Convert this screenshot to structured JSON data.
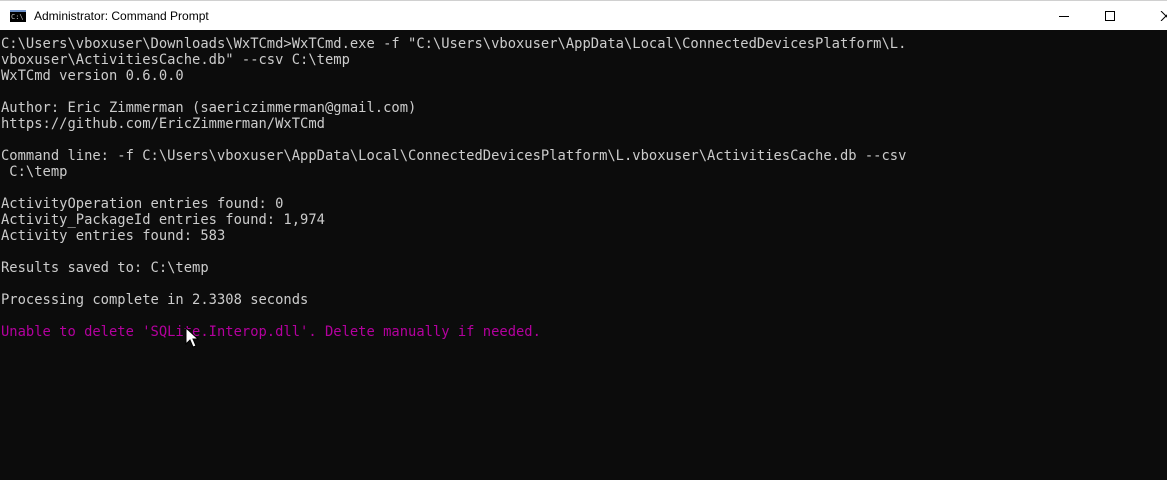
{
  "window": {
    "title": "Administrator: Command Prompt",
    "icon_text": "C:\\",
    "icon": "cmd-icon",
    "controls": {
      "minimize": "minimize-icon",
      "maximize": "maximize-icon",
      "close": "close-icon"
    }
  },
  "colors": {
    "console_bg": "#0c0c0c",
    "console_text": "#cccccc",
    "error_text": "#b4009e",
    "titlebar_bg": "#ffffff"
  },
  "console": {
    "lines": [
      {
        "text": "C:\\Users\\vboxuser\\Downloads\\WxTCmd>WxTCmd.exe -f \"C:\\Users\\vboxuser\\AppData\\Local\\ConnectedDevicesPlatform\\L.",
        "kind": "normal"
      },
      {
        "text": "vboxuser\\ActivitiesCache.db\" --csv C:\\temp",
        "kind": "normal"
      },
      {
        "text": "WxTCmd version 0.6.0.0",
        "kind": "normal"
      },
      {
        "text": "",
        "kind": "normal"
      },
      {
        "text": "Author: Eric Zimmerman (saericzimmerman@gmail.com)",
        "kind": "normal"
      },
      {
        "text": "https://github.com/EricZimmerman/WxTCmd",
        "kind": "normal"
      },
      {
        "text": "",
        "kind": "normal"
      },
      {
        "text": "Command line: -f C:\\Users\\vboxuser\\AppData\\Local\\ConnectedDevicesPlatform\\L.vboxuser\\ActivitiesCache.db --csv",
        "kind": "normal"
      },
      {
        "text": " C:\\temp",
        "kind": "normal"
      },
      {
        "text": "",
        "kind": "normal"
      },
      {
        "text": "ActivityOperation entries found: 0",
        "kind": "normal"
      },
      {
        "text": "Activity_PackageId entries found: 1,974",
        "kind": "normal"
      },
      {
        "text": "Activity entries found: 583",
        "kind": "normal"
      },
      {
        "text": "",
        "kind": "normal"
      },
      {
        "text": "Results saved to: C:\\temp",
        "kind": "normal"
      },
      {
        "text": "",
        "kind": "normal"
      },
      {
        "text": "Processing complete in 2.3308 seconds",
        "kind": "normal"
      },
      {
        "text": "",
        "kind": "normal"
      },
      {
        "text": "Unable to delete 'SQLite.Interop.dll'. Delete manually if needed.",
        "kind": "error"
      }
    ]
  }
}
